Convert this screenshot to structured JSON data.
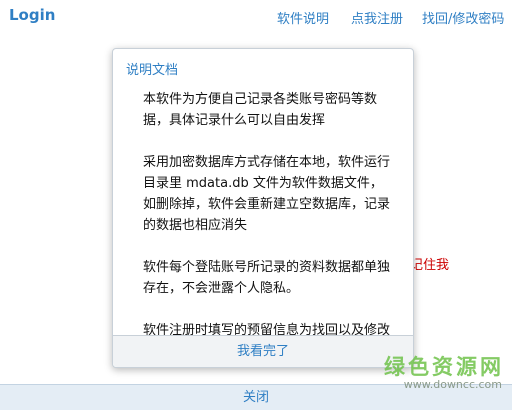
{
  "header": {
    "title": "Login",
    "nav": [
      "软件说明",
      "点我注册",
      "找回/修改密码"
    ]
  },
  "background_text": "记住我",
  "dialog": {
    "title": "说明文档",
    "paragraphs": [
      "本软件为方便自己记录各类账号密码等数据，具体记录什么可以自由发挥",
      "采用加密数据库方式存储在本地，软件运行目录里 mdata.db 文件为软件数据文件，如删除掉，软件会重新建立空数据库，记录的数据也相应消失",
      "软件每个登陆账号所记录的资料数据都单独存在，不会泄露个人隐私。",
      "软件注册时填写的预留信息为找回以及修改登陆密码时的信息，必须牢记"
    ],
    "ok_button": "我看完了"
  },
  "footer": {
    "close": "关闭"
  },
  "watermark": {
    "main": "绿色资源网",
    "sub": "www.downcc.com"
  },
  "colors": {
    "accent": "#2f7fc4",
    "red": "#cc0000",
    "watermark_green": "#6fc24a"
  }
}
